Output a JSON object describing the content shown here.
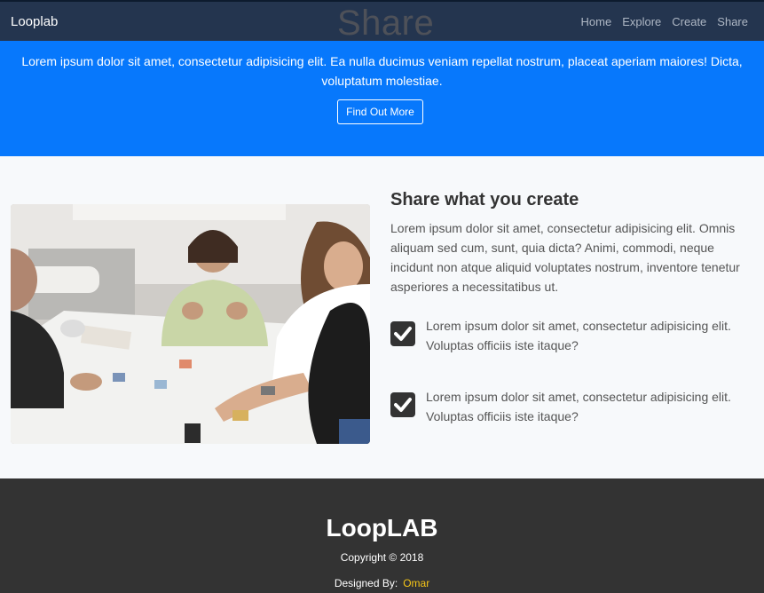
{
  "nav": {
    "brand": "Looplab",
    "ghost_title": "Share",
    "links": [
      "Home",
      "Explore",
      "Create",
      "Share"
    ]
  },
  "hero": {
    "text": "Lorem ipsum dolor sit amet, consectetur adipisicing elit. Ea nulla ducimus veniam repellat nostrum, placeat aperiam maiores! Dicta, voluptatum molestiae.",
    "button_label": "Find Out More"
  },
  "feature": {
    "heading": "Share what you create",
    "lead": "Lorem ipsum dolor sit amet, consectetur adipisicing elit. Omnis aliquam sed cum, sunt, quia dicta? Animi, commodi, neque incidunt non atque aliquid voluptates nostrum, inventore tenetur asperiores a necessitatibus ut.",
    "checks": [
      "Lorem ipsum dolor sit amet, consectetur adipisicing elit. Voluptas officiis iste itaque?",
      "Lorem ipsum dolor sit amet, consectetur adipisicing elit. Voluptas officiis iste itaque?"
    ]
  },
  "footer": {
    "title": "LoopLAB",
    "copyright": "Copyright © 2018",
    "designed_by_label": "Designed By:",
    "designer": "Omar"
  },
  "colors": {
    "nav_bg": "#24354f",
    "hero_bg": "#0778fc",
    "footer_bg": "#333333",
    "designer_accent": "#f5c518"
  }
}
